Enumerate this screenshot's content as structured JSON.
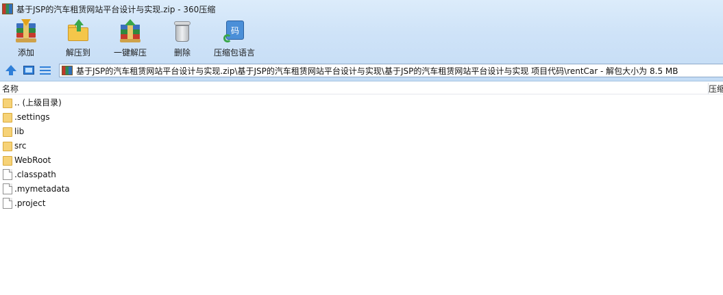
{
  "window": {
    "title": "基于JSP的汽车租赁网站平台设计与实现.zip - 360压缩"
  },
  "toolbar": {
    "buttons": [
      {
        "label": "添加",
        "icon": "add-archive-icon"
      },
      {
        "label": "解压到",
        "icon": "extract-to-icon"
      },
      {
        "label": "一键解压",
        "icon": "one-click-extract-icon"
      },
      {
        "label": "删除",
        "icon": "delete-icon"
      },
      {
        "label": "压缩包语言",
        "icon": "archive-language-icon",
        "glyph": "码"
      }
    ]
  },
  "navigation": {
    "path": "基于JSP的汽车租赁网站平台设计与实现.zip\\基于JSP的汽车租赁网站平台设计与实现\\基于JSP的汽车租赁网站平台设计与实现 项目代码\\rentCar - 解包大小为 8.5 MB"
  },
  "columns": {
    "name": "名称",
    "size": "压缩"
  },
  "files": [
    {
      "name": ".. (上级目录)",
      "type": "folder"
    },
    {
      "name": ".settings",
      "type": "folder"
    },
    {
      "name": "lib",
      "type": "folder"
    },
    {
      "name": "src",
      "type": "folder"
    },
    {
      "name": "WebRoot",
      "type": "folder"
    },
    {
      "name": ".classpath",
      "type": "file"
    },
    {
      "name": ".mymetadata",
      "type": "file"
    },
    {
      "name": ".project",
      "type": "file"
    }
  ],
  "colors": {
    "toolbar_bg": "#cfe3f8",
    "folder": "#f6d277",
    "accent": "#2f7fd8"
  }
}
